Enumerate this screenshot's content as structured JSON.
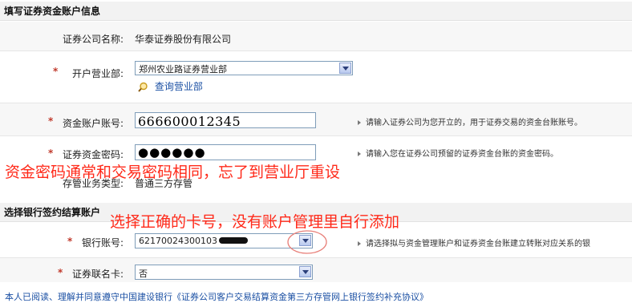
{
  "section1": {
    "title": "填写证券资金账户信息"
  },
  "broker": {
    "label": "证券公司名称:",
    "value": "华泰证券股份有限公司"
  },
  "branch": {
    "label": "开户营业部:",
    "selected": "郑州农业路证券营业部",
    "query_link": "查询营业部"
  },
  "fund_account": {
    "label": "资金账户账号:",
    "value": "666600012345",
    "hint": "请输入证券公司为您开立的，用于证券交易的资金台账账号。"
  },
  "fund_password": {
    "label": "证券资金密码:",
    "masked": "●●●●●●",
    "hint": "请输入您在证券公司预留的证券资金台账的资金密码。"
  },
  "annotation1": "资金密码通常和交易密码相同，忘了到营业厅重设",
  "deposit_type": {
    "label": "存管业务类型:",
    "value": "普通三方存管"
  },
  "section2": {
    "title": "选择银行签约结算账户"
  },
  "annotation2": "选择正确的卡号，没有账户管理里自行添加",
  "bank_account": {
    "label": "银行账号:",
    "selected": "62170024300103",
    "hint": "请选择拟与资金管理账户和证券资金台账建立转账对应关系的银"
  },
  "linked_card": {
    "label": "证券联名卡:",
    "selected": "否"
  },
  "agreement": "本人已阅读、理解并同意遵守中国建设银行《证券公司客户交易结算资金第三方存管网上银行签约补充协议》",
  "required_mark": "*"
}
